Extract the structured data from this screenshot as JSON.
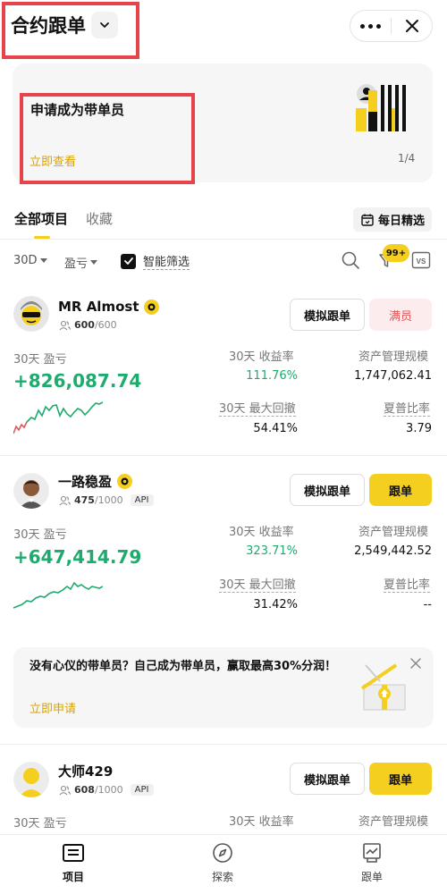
{
  "header": {
    "title": "合约跟单",
    "icons": {
      "dropdown": "chevron-down-icon",
      "more": "more-icon",
      "close": "close-icon"
    },
    "highlight_color": "#e7434a"
  },
  "banner": {
    "title": "申请成为带单员",
    "link": "立即查看",
    "pager": "1/4"
  },
  "tabs": {
    "items": [
      "全部项目",
      "收藏"
    ],
    "active": "全部项目",
    "daily_pick": "每日精选"
  },
  "filters": {
    "period": "30D",
    "sort": "盈亏",
    "smart_filter": "智能筛选",
    "smart_filter_checked": true,
    "badge": "99+",
    "compare": "VS"
  },
  "traders": [
    {
      "name": "MR Almost",
      "members_current": "600",
      "members_total": "/600",
      "api": "",
      "sim_button": "模拟跟单",
      "follow_button": "满员",
      "pnl_label": "30天 盈亏",
      "pnl": "+826,087.74",
      "roi_label": "30天 收益率",
      "roi": "111.76%",
      "aum_label": "资产管理规模",
      "aum": "1,747,062.41",
      "mdd_label": "30天 最大回撤",
      "mdd": "54.41%",
      "sharpe_label": "夏普比率",
      "sharpe": "3.79"
    },
    {
      "name": "一路稳盈",
      "members_current": "475",
      "members_total": "/1000",
      "api": "API",
      "sim_button": "模拟跟单",
      "follow_button": "跟单",
      "pnl_label": "30天 盈亏",
      "pnl": "+647,414.79",
      "roi_label": "30天 收益率",
      "roi": "323.71%",
      "aum_label": "资产管理规模",
      "aum": "2,549,442.52",
      "mdd_label": "30天 最大回撤",
      "mdd": "31.42%",
      "sharpe_label": "夏普比率",
      "sharpe": "--"
    },
    {
      "name": "大师429",
      "members_current": "608",
      "members_total": "/1000",
      "api": "API",
      "sim_button": "模拟跟单",
      "follow_button": "跟单",
      "pnl_label": "30天 盈亏",
      "roi_label": "30天 收益率",
      "aum_label": "资产管理规模"
    }
  ],
  "promo": {
    "text": "没有心仪的带单员？自己成为带单员，赢取最高30%分润！",
    "link": "立即申请"
  },
  "bottom_nav": {
    "items": [
      "项目",
      "探索",
      "跟单"
    ],
    "active": "项目"
  },
  "colors": {
    "accent": "#f5cf1f",
    "link": "#d9a300",
    "profit": "#1faa6e",
    "loss": "#e25757"
  }
}
